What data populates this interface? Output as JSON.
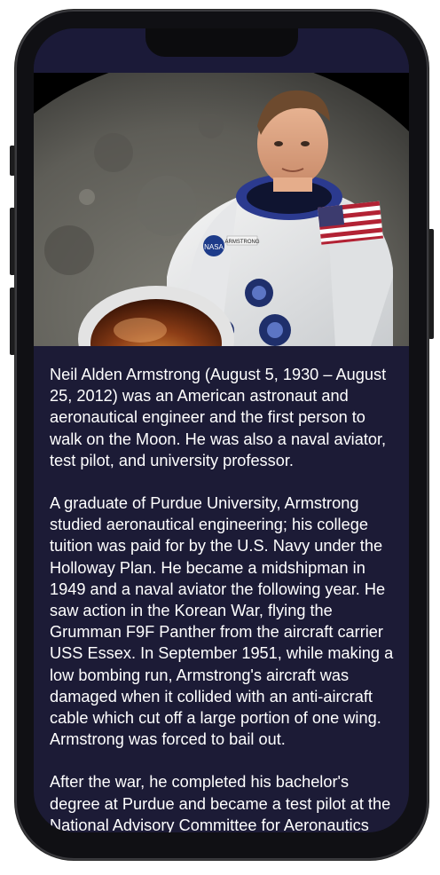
{
  "article": {
    "image_alt": "Neil Armstrong in astronaut suit",
    "paragraphs": [
      "Neil Alden Armstrong (August 5, 1930 – August 25, 2012) was an American astronaut and aeronautical engineer and the first person to walk on the Moon. He was also a naval aviator, test pilot, and university professor.",
      "A graduate of Purdue University, Armstrong studied aeronautical engineering; his college tuition was paid for by the U.S. Navy under the Holloway Plan. He became a midshipman in 1949 and a naval aviator the following year. He saw action in the Korean War, flying the Grumman F9F Panther from the aircraft carrier USS Essex. In September 1951, while making a low bombing run, Armstrong's aircraft was damaged when it collided with an anti-aircraft cable which cut off a large portion of one wing. Armstrong was forced to bail out.",
      "After the war, he completed his bachelor's degree at Purdue and became a test pilot at the National Advisory Committee for Aeronautics (NACA) High-Speed Flight Station"
    ],
    "suit_badges": {
      "agency": "NASA",
      "name_tag": "ARMSTRONG"
    }
  },
  "colors": {
    "screen_bg": "#1c1b36",
    "text": "#ffffff"
  }
}
